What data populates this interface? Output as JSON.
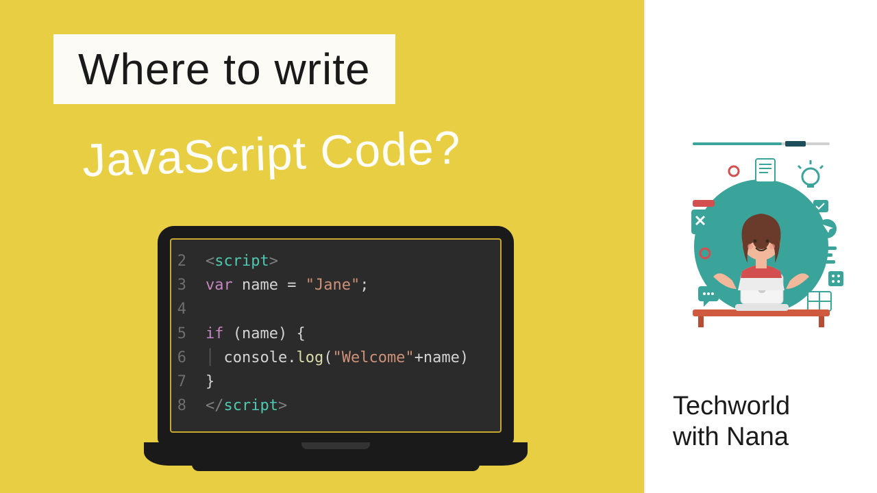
{
  "title": "Where to write",
  "subtitle": "JavaScript Code?",
  "code": {
    "lines": [
      {
        "num": "2",
        "tokens": [
          {
            "t": "tag-bracket",
            "v": "<"
          },
          {
            "t": "tag-name",
            "v": "script"
          },
          {
            "t": "tag-bracket",
            "v": ">"
          }
        ]
      },
      {
        "num": "3",
        "tokens": [
          {
            "t": "kw",
            "v": "var"
          },
          {
            "t": "lit",
            "v": " name "
          },
          {
            "t": "lit",
            "v": "= "
          },
          {
            "t": "str",
            "v": "\"Jane\""
          },
          {
            "t": "lit",
            "v": ";"
          }
        ]
      },
      {
        "num": "4",
        "tokens": []
      },
      {
        "num": "5",
        "tokens": [
          {
            "t": "kw",
            "v": "if"
          },
          {
            "t": "lit",
            "v": " (name) {"
          }
        ]
      },
      {
        "num": "6",
        "tokens": [
          {
            "t": "gutter-mark",
            "v": "│"
          },
          {
            "t": "lit",
            "v": " console."
          },
          {
            "t": "fn",
            "v": "log"
          },
          {
            "t": "lit",
            "v": "("
          },
          {
            "t": "str",
            "v": "\"Welcome\""
          },
          {
            "t": "lit",
            "v": "+name)"
          }
        ]
      },
      {
        "num": "7",
        "tokens": [
          {
            "t": "lit",
            "v": "}"
          }
        ]
      },
      {
        "num": "8",
        "tokens": [
          {
            "t": "tag-bracket",
            "v": "</"
          },
          {
            "t": "tag-name",
            "v": "script"
          },
          {
            "t": "tag-bracket",
            "v": ">"
          }
        ]
      }
    ]
  },
  "brand": {
    "line1": "Techworld",
    "line2": "with Nana"
  },
  "colors": {
    "accent": "#e8ce43",
    "teal": "#3aa39a",
    "red": "#d34e4e"
  }
}
